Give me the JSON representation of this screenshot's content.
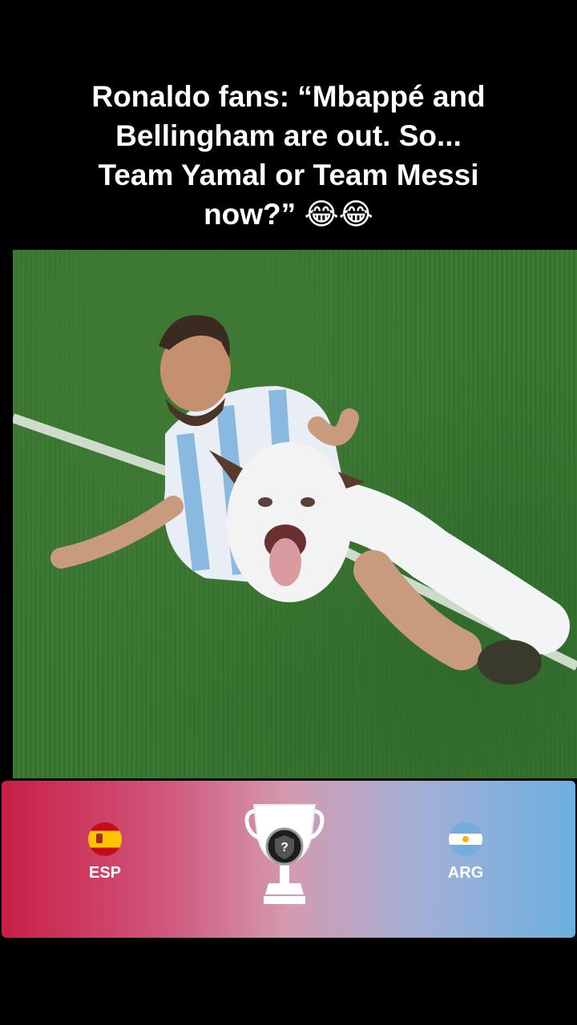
{
  "caption": {
    "line1": "Ronaldo fans: “Mbappé and",
    "line2": "Bellingham are out. So...",
    "line3": "Team Yamal or Team Messi",
    "line4": "now?” 😂😂"
  },
  "matchup": {
    "home": {
      "code": "ESP",
      "flag_icon": "spain-flag-icon"
    },
    "away": {
      "code": "ARG",
      "flag_icon": "argentina-flag-icon"
    },
    "trophy_icon": "trophy-icon",
    "winner_badge": "?"
  },
  "colors": {
    "card_left": "#c81f47",
    "card_right": "#6cb0e0",
    "pitch": "#3d7a34"
  }
}
